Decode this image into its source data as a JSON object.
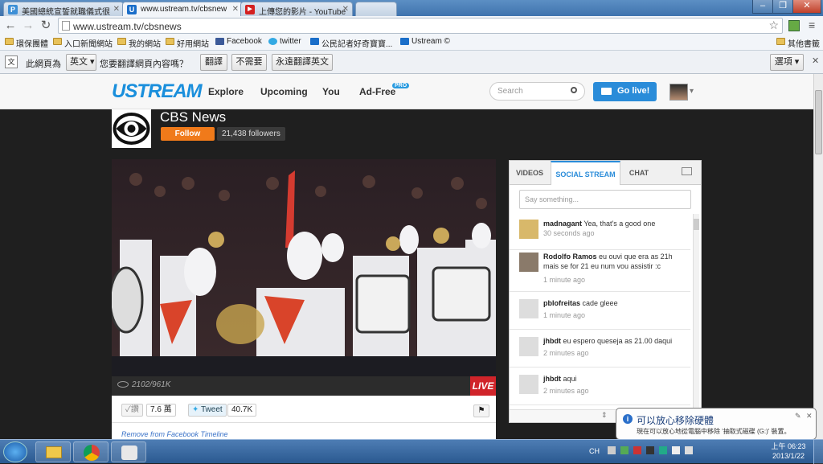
{
  "browser": {
    "tabs": [
      {
        "title": "美國總統宣誓就職儀式很",
        "favicon": "P"
      },
      {
        "title": "www.ustream.tv/cbsnew",
        "favicon": "U"
      },
      {
        "title": "上傳您的影片 - YouTube",
        "favicon": "▶"
      }
    ],
    "window_controls": [
      "–",
      "❐",
      "✕"
    ],
    "url": "www.ustream.tv/cbsnews",
    "bookmarks": [
      "環保團體",
      "入口新聞網站",
      "我的網站",
      "好用網站",
      "Facebook",
      "twitter",
      "公民記者好奇寶寶...",
      "Ustream ©"
    ],
    "other_bookmarks": "其他書籤"
  },
  "translate_bar": {
    "prefix": "此網頁為",
    "language": "英文",
    "question": "您要翻譯網頁內容嗎？",
    "translate": "翻譯",
    "nope": "不需要",
    "always": "永遠翻譯英文",
    "options": "選項"
  },
  "ustream": {
    "logo": "USTREAM",
    "nav": [
      "Explore",
      "Upcoming",
      "You",
      "Ad-Free"
    ],
    "pro_badge": "PRO",
    "search_placeholder": "Search",
    "go_live": "Go live!"
  },
  "channel": {
    "name": "CBS News",
    "follow": "Follow",
    "followers": "21,438 followers"
  },
  "video": {
    "views": "2102/961K",
    "live": "LIVE"
  },
  "share": {
    "like_label": "讚",
    "like_count": "7.6 萬",
    "tweet": "Tweet",
    "tweet_count": "40.7K",
    "remove_fb": "Remove from Facebook Timeline"
  },
  "social": {
    "tabs": [
      "VIDEOS",
      "SOCIAL STREAM",
      "CHAT"
    ],
    "placeholder": "Say something...",
    "messages": [
      {
        "user": "madnagant",
        "text": "Yea, that's a good one",
        "time": "30 seconds ago"
      },
      {
        "user": "Rodolfo Ramos",
        "text": "eu ouvi que era as 21h mais se for 21 eu num vou assistir :c",
        "time": "1 minute ago"
      },
      {
        "user": "pblofreitas",
        "text": "cade gleee",
        "time": "1 minute ago"
      },
      {
        "user": "jhbdt",
        "text": "eu espero queseja as 21.00 daqui",
        "time": "2 minutes ago"
      },
      {
        "user": "jhbdt",
        "text": "aqui",
        "time": "2 minutes ago"
      }
    ]
  },
  "notification": {
    "title": "可以放心移除硬體",
    "body": "現在可以放心地從電腦中移除 '抽取式磁碟 (G:)' 裝置。"
  },
  "taskbar": {
    "lang": "CH",
    "time": "上午 06:23",
    "date": "2013/1/22"
  }
}
